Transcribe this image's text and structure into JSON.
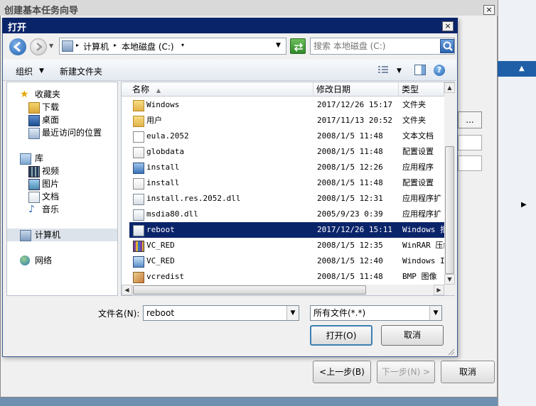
{
  "wizard": {
    "title": "创建基本任务向导",
    "close_glyph": "×",
    "back_label": "<上一步(B)",
    "next_label": "下一步(N) >",
    "cancel_label": "取消",
    "browse_partial": "..."
  },
  "dialog": {
    "title": "打开",
    "close_glyph": "×",
    "breadcrumb": [
      "计算机",
      "本地磁盘 (C:)"
    ],
    "search_placeholder": "搜索 本地磁盘 (C:)",
    "toolbar": {
      "organize": "组织",
      "new_folder": "新建文件夹"
    },
    "nav": {
      "favorites": "收藏夹",
      "downloads": "下载",
      "desktop": "桌面",
      "recent": "最近访问的位置",
      "libraries": "库",
      "videos": "视频",
      "pictures": "图片",
      "documents": "文档",
      "music": "音乐",
      "computer": "计算机",
      "network": "网络"
    },
    "columns": {
      "name": "名称",
      "date": "修改日期",
      "type": "类型"
    },
    "files": [
      {
        "name": "Windows",
        "date": "2017/12/26 15:17",
        "type": "文件夹",
        "icon": "folder-icon"
      },
      {
        "name": "用户",
        "date": "2017/11/13 20:52",
        "type": "文件夹",
        "icon": "folder-icon"
      },
      {
        "name": "eula.2052",
        "date": "2008/1/5 11:48",
        "type": "文本文档",
        "icon": "text-file-icon"
      },
      {
        "name": "globdata",
        "date": "2008/1/5 11:48",
        "type": "配置设置",
        "icon": "config-file-icon"
      },
      {
        "name": "install",
        "date": "2008/1/5 12:26",
        "type": "应用程序",
        "icon": "application-icon"
      },
      {
        "name": "install",
        "date": "2008/1/5 11:48",
        "type": "配置设置",
        "icon": "config-file-icon"
      },
      {
        "name": "install.res.2052.dll",
        "date": "2008/1/5 12:31",
        "type": "应用程序扩",
        "icon": "dll-file-icon"
      },
      {
        "name": "msdia80.dll",
        "date": "2005/9/23 0:39",
        "type": "应用程序扩",
        "icon": "dll-file-icon"
      },
      {
        "name": "reboot",
        "date": "2017/12/26 15:11",
        "type": "Windows 批",
        "icon": "batch-file-icon",
        "selected": true
      },
      {
        "name": "VC_RED",
        "date": "2008/1/5 12:35",
        "type": "WinRAR 压缩",
        "icon": "winrar-archive-icon"
      },
      {
        "name": "VC_RED",
        "date": "2008/1/5 12:40",
        "type": "Windows In",
        "icon": "installer-file-icon"
      },
      {
        "name": "vcredist",
        "date": "2008/1/5 11:48",
        "type": "BMP 图像",
        "icon": "bmp-image-icon"
      }
    ],
    "filename_label": "文件名(N):",
    "filename_value": "reboot",
    "filter_value": "所有文件(*.*)",
    "open_button": "打开(O)",
    "cancel_button": "取消"
  }
}
